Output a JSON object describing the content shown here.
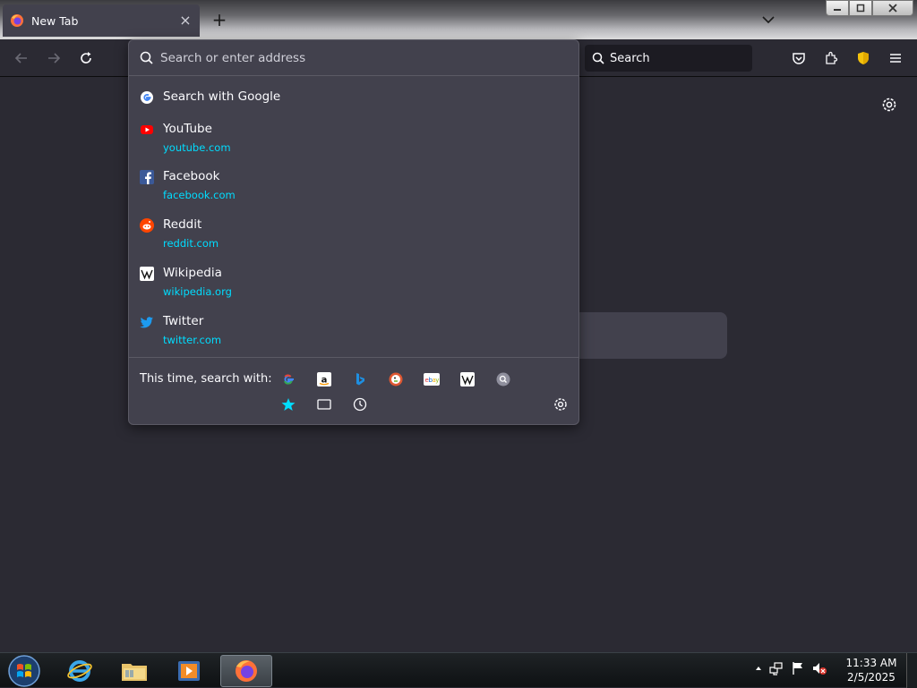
{
  "browser": {
    "tab": {
      "title": "New Tab",
      "close": "×"
    },
    "new_tab": "+",
    "search_box": {
      "placeholder": "Search"
    },
    "urlbar": {
      "placeholder": "Search or enter address"
    }
  },
  "dropdown": {
    "search_suggestion": "Search with Google",
    "results": [
      {
        "title": "YouTube",
        "url": "youtube.com",
        "icon": "youtube-icon"
      },
      {
        "title": "Facebook",
        "url": "facebook.com",
        "icon": "facebook-icon"
      },
      {
        "title": "Reddit",
        "url": "reddit.com",
        "icon": "reddit-icon"
      },
      {
        "title": "Wikipedia",
        "url": "wikipedia.org",
        "icon": "wikipedia-icon"
      },
      {
        "title": "Twitter",
        "url": "twitter.com",
        "icon": "twitter-icon"
      }
    ],
    "one_off_label": "This time, search with:",
    "engines": [
      "google-icon",
      "amazon-icon",
      "bing-icon",
      "duckduckgo-icon",
      "ebay-icon",
      "wikipedia-icon",
      "search-engine-icon"
    ],
    "modes": [
      "bookmarks-star-icon",
      "tabs-icon",
      "history-clock-icon"
    ]
  },
  "taskbar": {
    "time": "11:33 AM",
    "date": "2/5/2025"
  },
  "colors": {
    "accent_url": "#00ddff",
    "panel": "#42414d",
    "page": "#2b2a33"
  }
}
